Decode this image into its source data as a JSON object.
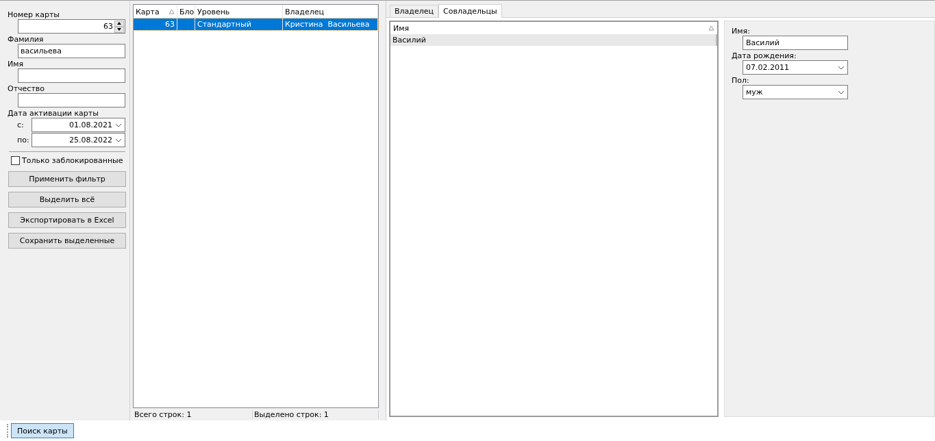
{
  "filter": {
    "card_number": {
      "label": "Номер карты",
      "value": "63"
    },
    "text_fields": [
      {
        "label": "Фамилия",
        "value": "васильева"
      },
      {
        "label": "Имя"
      },
      {
        "label": "Отчество"
      }
    ],
    "date_group": {
      "label": "Дата активации карты",
      "ranges": [
        {
          "label": "с:",
          "value": "01.08.2021"
        },
        {
          "label": "по:",
          "value": "25.08.2022"
        }
      ]
    },
    "blocked_only": {
      "label": "Только заблокированные",
      "checked": false
    },
    "buttons": [
      "Применить фильтр",
      "Выделить всё",
      "Экспортировать в Excel",
      "Сохранить выделенные"
    ]
  },
  "table": {
    "columns": [
      {
        "label": "Карта",
        "sorted": true
      },
      {
        "label": "Бло",
        "sorted": false
      },
      {
        "label": "Уровень",
        "sorted": false
      },
      {
        "label": "Владелец",
        "sorted": false
      }
    ],
    "rows": [
      {
        "cells": [
          "63",
          "",
          "Стандартный",
          "Кристина  Васильева"
        ],
        "selected": true
      }
    ]
  },
  "status_bar": [
    "Всего строк: 1",
    "Выделено строк: 1"
  ],
  "tabs": [
    {
      "label": "Владелец",
      "selected": false
    },
    {
      "label": "Совладельцы",
      "selected": true
    }
  ],
  "co_owners": {
    "column": {
      "label": "Имя",
      "sorted": true
    },
    "rows": [
      {
        "name": "Василий",
        "selected": true
      }
    ]
  },
  "details": [
    {
      "label": "Имя:",
      "value": "Василий",
      "kind": "text"
    },
    {
      "label": "Дата рождения:",
      "value": "07.02.2011",
      "kind": "select"
    },
    {
      "label": "Пол:",
      "value": "муж",
      "kind": "select"
    }
  ],
  "taskbar": [
    {
      "label": "Поиск карты",
      "selected": true
    }
  ]
}
